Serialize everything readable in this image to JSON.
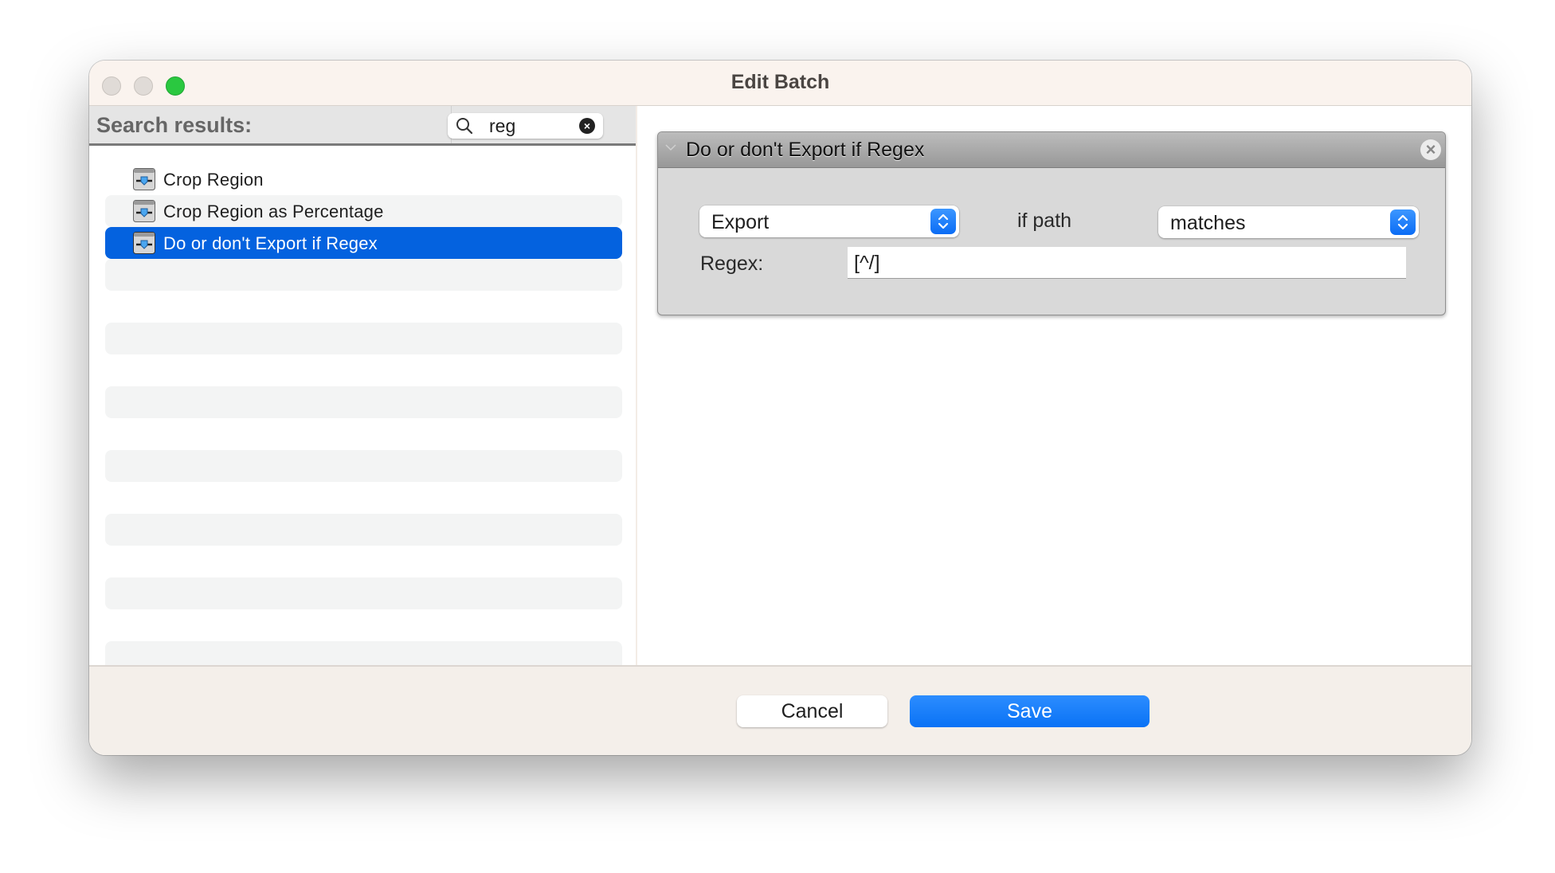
{
  "window": {
    "title": "Edit Batch",
    "controls": [
      "close",
      "minimize",
      "zoom"
    ]
  },
  "sidebar": {
    "header_label": "Search results:",
    "search": {
      "value": "reg",
      "icon": "search-icon",
      "clear_icon": "clear-icon",
      "clear_glyph": "×"
    },
    "items": [
      {
        "label": "Crop Region",
        "icon": "slider-action-icon",
        "selected": false
      },
      {
        "label": "Crop Region as Percentage",
        "icon": "slider-action-icon",
        "selected": false
      },
      {
        "label": "Do or don't Export if Regex",
        "icon": "slider-action-icon",
        "selected": true
      }
    ]
  },
  "action_panel": {
    "title": "Do or don't Export if Regex",
    "close_glyph": "×",
    "mode_select": {
      "value": "Export"
    },
    "condition_label": "if path",
    "match_select": {
      "value": "matches"
    },
    "regex_label": "Regex:",
    "regex_value": "[^/]"
  },
  "footer": {
    "cancel_label": "Cancel",
    "save_label": "Save"
  },
  "colors": {
    "accent": "#0a72f5",
    "selection": "#0462df",
    "zoom_button": "#2ac840"
  }
}
